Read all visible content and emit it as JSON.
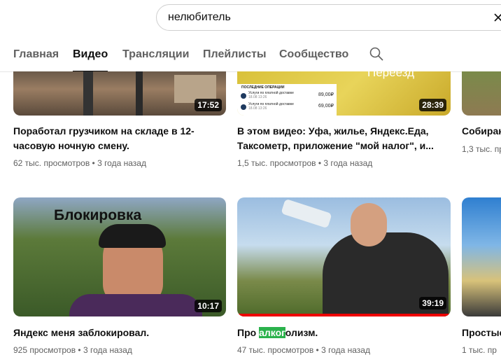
{
  "search": {
    "query": "нелюбитель"
  },
  "tabs": [
    "Главная",
    "Видео",
    "Трансляции",
    "Плейлисты",
    "Сообщество"
  ],
  "videos": [
    {
      "title": "Поработал грузчиком на складе в 12-часовую ночную смену.",
      "title_l1": "Поработал грузчиком на складе в 12-",
      "title_l2": "часовую ночную смену.",
      "duration": "17:52",
      "meta": "62 тыс. просмотров • 3 года назад"
    },
    {
      "title_l1": "В этом видео: Уфа, жилье, Яндекс.Еда,",
      "title_l2": "Таксометр, приложение \"мой налог\", и...",
      "duration": "28:39",
      "meta": "1,5 тыс. просмотров • 3 года назад",
      "thumb_text": "Переезд",
      "thumb_list": {
        "header": "ПОСЛЕДНИЕ ОПЕРАЦИИ",
        "rows": [
          {
            "label": "Услуги по платной доставке",
            "date": "18.08 13:26",
            "amount": "89,00₽"
          },
          {
            "label": "Услуги по платной доставке",
            "date": "18.08 13:26",
            "amount": "69,00₽"
          }
        ]
      }
    },
    {
      "title_l1": "Собирак",
      "duration": "",
      "meta": "1,3 тыс. пр"
    },
    {
      "title_l1": "Яндекс меня заблокировал.",
      "duration": "10:17",
      "meta": "925 просмотров • 3 года назад",
      "thumb_text": "Блокировка"
    },
    {
      "title_pre": "Про ",
      "title_hl": "алког",
      "title_post": "олизм.",
      "duration": "39:19",
      "meta": "47 тыс. просмотров • 3 года назад",
      "progress": 1.0
    },
    {
      "title_l1": "Простые",
      "meta": "1 тыс. пр"
    }
  ],
  "colors": {
    "accent_red": "#e00000",
    "highlight": "#2bb24c"
  }
}
